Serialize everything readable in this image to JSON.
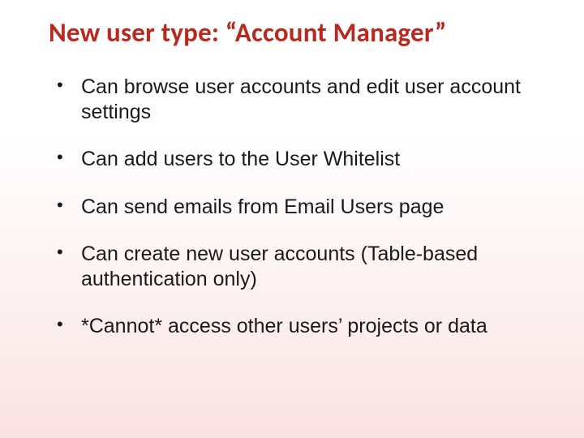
{
  "slide": {
    "title": "New user type: “Account Manager”",
    "bullets": [
      "Can browse user accounts and edit user account settings",
      "Can add users to the User Whitelist",
      "Can send emails from Email Users page",
      "Can create new user accounts (Table-based authentication only)",
      "*Cannot* access other users’ projects or data"
    ]
  }
}
